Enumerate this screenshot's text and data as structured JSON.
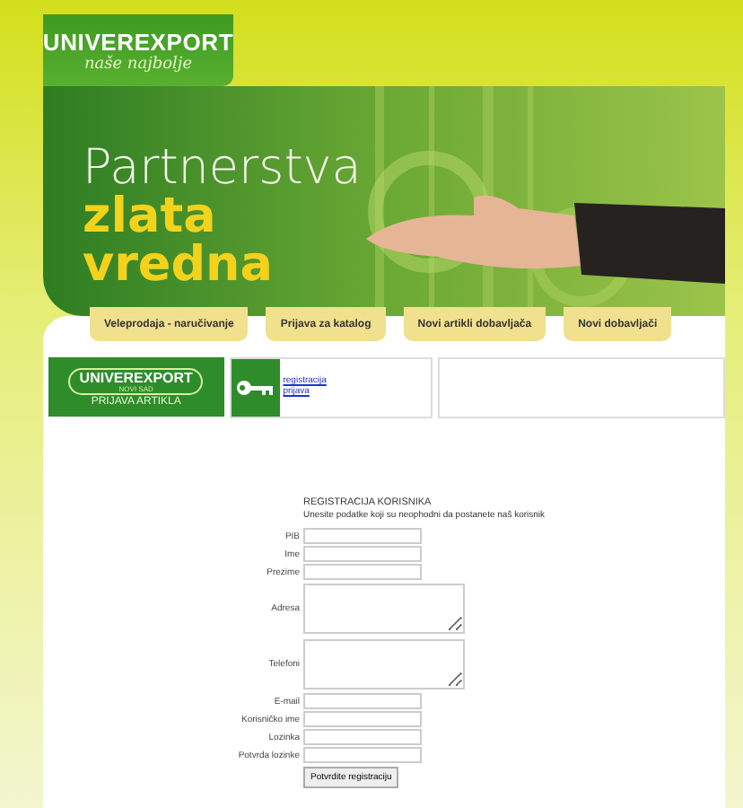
{
  "logo": {
    "name": "UNIVEREXPORT",
    "slogan": "naše najbolje"
  },
  "banner": {
    "line_1": "Partnerstva",
    "line_2": "zlata",
    "line_3": "vredna"
  },
  "tabs": [
    {
      "label": "Veleprodaja - naručivanje"
    },
    {
      "label": "Prijava za katalog"
    },
    {
      "label": "Novi artikli dobavljača"
    },
    {
      "label": "Novi dobavljači"
    }
  ],
  "promo": {
    "name": "UNIVEREXPORT",
    "city": "NOVI SAD",
    "caption": "PRIJAVA ARTIKLA"
  },
  "login_links": [
    "registracija",
    "prijava"
  ],
  "form": {
    "title": "REGISTRACIJA KORISNIKA",
    "subtitle": "Unesite podatke koji su neophodni da postanete naš korisnik",
    "fields": [
      {
        "label": "PIB",
        "kind": "input"
      },
      {
        "label": "Ime",
        "kind": "input"
      },
      {
        "label": "Prezime",
        "kind": "input"
      },
      {
        "label": "Adresa",
        "kind": "textarea"
      },
      {
        "label": "Telefoni",
        "kind": "textarea"
      },
      {
        "label": "E-mail",
        "kind": "input"
      },
      {
        "label": "Korisničko ime",
        "kind": "input"
      },
      {
        "label": "Lozinka",
        "kind": "input"
      },
      {
        "label": "Potvrda lozinke",
        "kind": "input"
      }
    ],
    "submit": "Potvrdite registraciju"
  }
}
